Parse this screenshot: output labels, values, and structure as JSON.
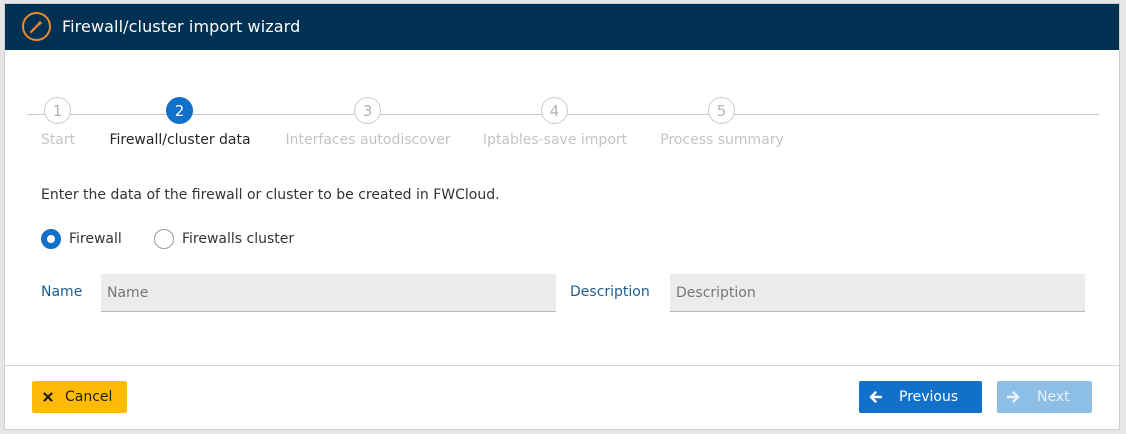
{
  "window": {
    "title": "Firewall/cluster import wizard"
  },
  "steps": [
    {
      "number": "1",
      "label": "Start",
      "active": false
    },
    {
      "number": "2",
      "label": "Firewall/cluster data",
      "active": true
    },
    {
      "number": "3",
      "label": "Interfaces autodiscover",
      "active": false
    },
    {
      "number": "4",
      "label": "Iptables-save import",
      "active": false
    },
    {
      "number": "5",
      "label": "Process summary",
      "active": false
    }
  ],
  "form": {
    "intro": "Enter the data of the firewall or cluster to be created in FWCloud.",
    "type_options": [
      {
        "label": "Firewall",
        "checked": true
      },
      {
        "label": "Firewalls cluster",
        "checked": false
      }
    ],
    "name_label": "Name",
    "name_placeholder": "Name",
    "name_value": "",
    "description_label": "Description",
    "description_placeholder": "Description",
    "description_value": ""
  },
  "footer": {
    "cancel_label": "Cancel",
    "previous_label": "Previous",
    "next_label": "Next",
    "next_enabled": false
  },
  "colors": {
    "titlebar": "#003052",
    "accent": "#1170c9",
    "cancel": "#ffba08",
    "icon_orange": "#f08a24"
  },
  "icons": {
    "title": "magic-wand-icon",
    "cancel": "times-icon",
    "previous": "arrow-left-icon",
    "next": "arrow-right-icon"
  }
}
